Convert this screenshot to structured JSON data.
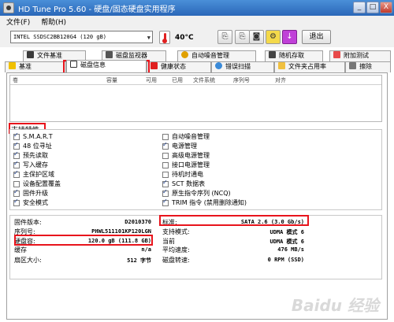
{
  "window": {
    "title": "HD Tune Pro 5.60 - 硬盘/固态硬盘实用程序",
    "buttons": [
      "_",
      "□",
      "X"
    ]
  },
  "menu": {
    "file": "文件(F)",
    "help": "帮助(H)"
  },
  "toolbar": {
    "drive": "INTEL SSDSC2BB120G4 (120 gB)",
    "temperature": "40°C",
    "exit_label": "退出"
  },
  "tabs": {
    "row1": [
      "文件基准",
      "磁盘监视器",
      "自动噪音管理",
      "随机存取",
      "附加测试"
    ],
    "row2": [
      "基准",
      "磁盘信息",
      "健康状态",
      "错误扫描",
      "文件夹占用率",
      "擦除"
    ]
  },
  "listview": {
    "columns": [
      "卷",
      "容量",
      "可用",
      "已用",
      "文件系统",
      "序列号",
      "对齐"
    ]
  },
  "features_title": "支持特性",
  "features_left": [
    {
      "label": "S.M.A.R.T",
      "checked": true
    },
    {
      "label": "48 位寻址",
      "checked": true
    },
    {
      "label": "预先读取",
      "checked": true
    },
    {
      "label": "写入缓存",
      "checked": true
    },
    {
      "label": "主保护区域",
      "checked": true
    },
    {
      "label": "设备配置覆盖",
      "checked": false
    },
    {
      "label": "固件升级",
      "checked": true
    },
    {
      "label": "安全模式",
      "checked": true
    }
  ],
  "features_right": [
    {
      "label": "自动噪音管理",
      "checked": false
    },
    {
      "label": "电源管理",
      "checked": true
    },
    {
      "label": "高级电源管理",
      "checked": false
    },
    {
      "label": "接口电源管理",
      "checked": false
    },
    {
      "label": "待机时通电",
      "checked": false
    },
    {
      "label": "SCT 数据表",
      "checked": true
    },
    {
      "label": "原生指令序列 (NCQ)",
      "checked": true
    },
    {
      "label": "TRIM 指令 (禁用删除通知)",
      "checked": true
    }
  ],
  "info_left": [
    {
      "label": "固件版本:",
      "value": "D2010370"
    },
    {
      "label": "序列号:",
      "value": "PHWL511101KP120LGN"
    },
    {
      "label": "硬盘容:",
      "value": "120.0 gB (111.8 GB)"
    },
    {
      "label": "缓存",
      "value": "n/a"
    },
    {
      "label": "扇区大小:",
      "value": "512 字节"
    }
  ],
  "info_right": [
    {
      "label": "标准:",
      "value": "SATA 2.6 (3.0 Gb/s)"
    },
    {
      "label": "支持模式:",
      "value": "UDMA 模式 6"
    },
    {
      "label": "当前",
      "value": "UDMA 模式 6"
    },
    {
      "label": "平均速度:",
      "value": "476 MB/s"
    },
    {
      "label": "磁盘转速:",
      "value": "0 RPM (SSD)"
    }
  ],
  "watermark": "Baidu 经验",
  "colors": {
    "highlight": "#e8141c",
    "titlebar": "#2a67b8"
  }
}
